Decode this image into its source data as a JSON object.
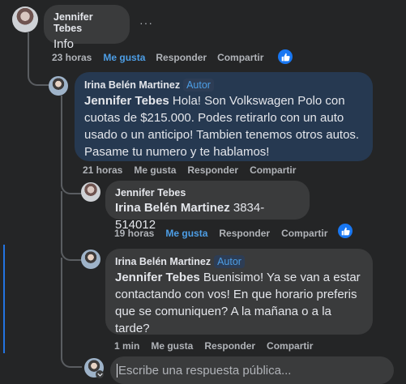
{
  "c1": {
    "author": "Jennifer Tebes",
    "text": "Info",
    "more": "···",
    "time": "23 horas",
    "like": "Me gusta",
    "reply": "Responder",
    "share": "Compartir"
  },
  "c2": {
    "author": "Irina Belén Martinez",
    "badge": "Autor",
    "mention": "Jennifer Tebes",
    "text": " Hola! Son Volkswagen Polo con cuotas de $215.000. Podes retirarlo con un auto usado o un anticipo! Tambien tenemos otros autos. Pasame tu numero y te hablamos!",
    "time": "21 horas",
    "like": "Me gusta",
    "reply": "Responder",
    "share": "Compartir"
  },
  "c3": {
    "author": "Jennifer Tebes",
    "mention": "Irina Belén Martinez",
    "text": " 3834-514012",
    "time": "19 horas",
    "like": "Me gusta",
    "reply": "Responder",
    "share": "Compartir"
  },
  "c4": {
    "author": "Irina Belén Martinez",
    "badge": "Autor",
    "mention": "Jennifer Tebes",
    "text": " Buenisimo! Ya se van a estar contactando con vos! En que horario preferis que se comuniquen? A la mañana o a la tarde?",
    "time": "1 min",
    "like": "Me gusta",
    "reply": "Responder",
    "share": "Compartir"
  },
  "reply_input": {
    "placeholder": "Escribe una respuesta pública..."
  },
  "colors": {
    "bg": "#242526",
    "bubble": "#3a3b3c",
    "author_bubble": "#263951",
    "accent": "#4d9ee6",
    "like_icon": "#1877f2"
  }
}
